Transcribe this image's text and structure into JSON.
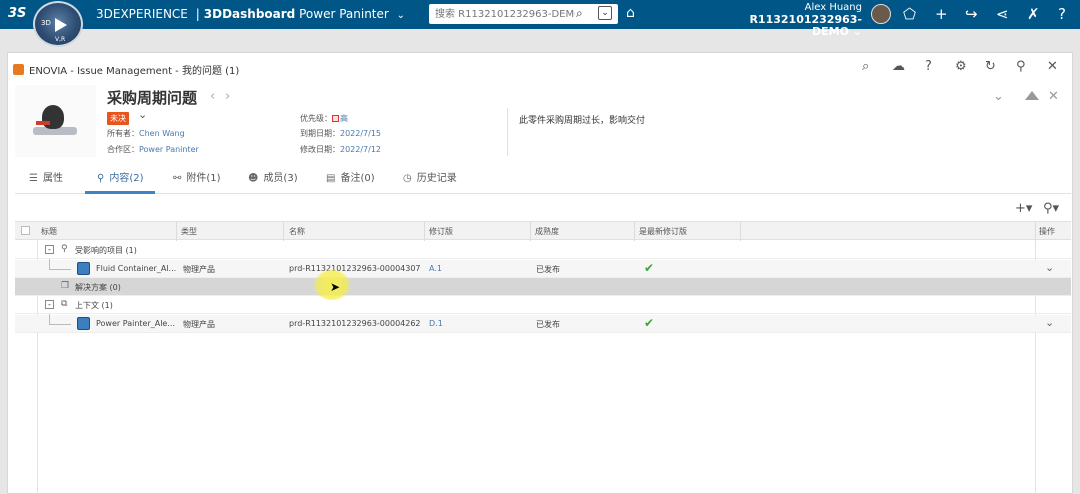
{
  "topbar": {
    "logo": "3S",
    "compass_label": "3D",
    "compass_version": "V,R",
    "brand_prefix": "3DEXPERIENCE",
    "brand_separator": "|",
    "brand_suffix": "3DDashboard",
    "dashboard": "Power Paninter",
    "search_placeholder": "搜索 R1132101232963-DEMO",
    "user_name": "Alex Huang",
    "tenant": "R1132101232963-DEMO"
  },
  "panel": {
    "title": "ENOVIA - Issue Management - 我的问题 (1)"
  },
  "issue": {
    "title": "采购周期问题",
    "status": "未决",
    "owner_label": "所有者：",
    "owner": "Chen Wang",
    "collab_label": "合作区：",
    "collab": "Power Paninter",
    "priority_label": "优先级：",
    "priority": "高",
    "due_label": "到期日期：",
    "due": "2022/7/15",
    "modified_label": "修改日期：",
    "modified": "2022/7/12",
    "description": "此零件采购周期过长，影响交付"
  },
  "tabs": [
    {
      "label": "属性"
    },
    {
      "label": "内容(2)"
    },
    {
      "label": "附件(1)"
    },
    {
      "label": "成员(3)"
    },
    {
      "label": "备注(0)"
    },
    {
      "label": "历史记录"
    }
  ],
  "grid": {
    "columns": [
      "标题",
      "类型",
      "名称",
      "修订版",
      "成熟度",
      "是最新修订版",
      "操作"
    ],
    "group1": {
      "label": "受影响的项目 (1)"
    },
    "row1": {
      "title": "Fluid Container_Al...",
      "type": "物理产品",
      "name": "prd-R1132101232963-00004307",
      "revision": "A.1",
      "maturity": "已发布"
    },
    "group2": {
      "label": "解决方案 (0)"
    },
    "group3": {
      "label": "上下文 (1)"
    },
    "row2": {
      "title": "Power Painter_Ale...",
      "type": "物理产品",
      "name": "prd-R1132101232963-00004262",
      "revision": "D.1",
      "maturity": "已发布"
    }
  },
  "colors": {
    "topbar": "#005686",
    "status_badge": "#e8541e",
    "link": "#4a79b0",
    "check": "#3aa63a",
    "tab_active": "#3d84c4"
  }
}
